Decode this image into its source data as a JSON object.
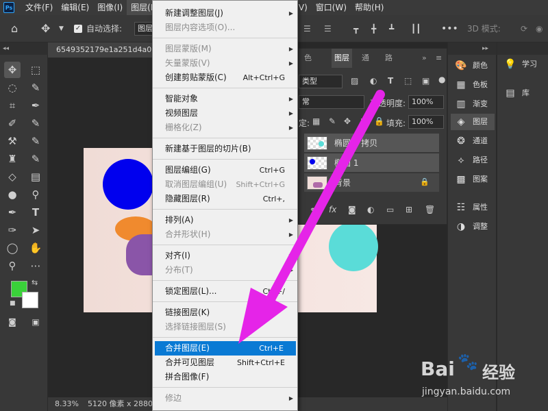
{
  "menubar": {
    "items": [
      "文件(F)",
      "编辑(E)",
      "图像(I)",
      "图层(L)",
      "(V)",
      "窗口(W)",
      "帮助(H)"
    ]
  },
  "options": {
    "auto_select_label": "自动选择:",
    "auto_select_value": "图层",
    "three_d_label": "3D 模式:"
  },
  "document": {
    "tab_title": "6549352179e1a251d4a028",
    "zoom": "8.33%",
    "size_info": "5120 像素 x 2880 像"
  },
  "layers_panel": {
    "tabs": [
      "色",
      "图层",
      "通",
      "路"
    ],
    "filter_kind": "类型",
    "blend_mode": "常",
    "opacity_label": "不透明度:",
    "opacity_value": "100%",
    "lock_label": "定:",
    "fill_label": "填充:",
    "fill_value": "100%",
    "layers": [
      {
        "name": "椭圆 1 拷贝"
      },
      {
        "name": "椭圆 1"
      },
      {
        "name": "背景"
      }
    ]
  },
  "right_panel": {
    "items": [
      {
        "icon": "palette-icon",
        "label": "颜色"
      },
      {
        "icon": "swatches-icon",
        "label": "色板"
      },
      {
        "icon": "gradient-icon",
        "label": "渐变"
      },
      {
        "icon": "layers-icon",
        "label": "图层"
      },
      {
        "icon": "channels-icon",
        "label": "通道"
      },
      {
        "icon": "paths-icon",
        "label": "路径"
      },
      {
        "icon": "patterns-icon",
        "label": "图案"
      },
      {
        "icon": "properties-icon",
        "label": "属性"
      },
      {
        "icon": "adjustments-icon",
        "label": "调整"
      }
    ],
    "learn_label": "学习",
    "library_label": "库"
  },
  "layer_menu": {
    "items": [
      {
        "label": "新建调整图层(J)",
        "shortcut": "",
        "submenu": true,
        "disabled": false
      },
      {
        "label": "图层内容选项(O)...",
        "shortcut": "",
        "submenu": false,
        "disabled": true
      },
      {
        "label": "图层蒙版(M)",
        "shortcut": "",
        "submenu": true,
        "disabled": true
      },
      {
        "label": "矢量蒙版(V)",
        "shortcut": "",
        "submenu": true,
        "disabled": true
      },
      {
        "label": "创建剪贴蒙版(C)",
        "shortcut": "Alt+Ctrl+G",
        "submenu": false,
        "disabled": false
      },
      {
        "label": "智能对象",
        "shortcut": "",
        "submenu": true,
        "disabled": false
      },
      {
        "label": "视频图层",
        "shortcut": "",
        "submenu": true,
        "disabled": false
      },
      {
        "label": "栅格化(Z)",
        "shortcut": "",
        "submenu": true,
        "disabled": true
      },
      {
        "label": "新建基于图层的切片(B)",
        "shortcut": "",
        "submenu": false,
        "disabled": false
      },
      {
        "label": "图层编组(G)",
        "shortcut": "Ctrl+G",
        "submenu": false,
        "disabled": false
      },
      {
        "label": "取消图层编组(U)",
        "shortcut": "Shift+Ctrl+G",
        "submenu": false,
        "disabled": true
      },
      {
        "label": "隐藏图层(R)",
        "shortcut": "Ctrl+,",
        "submenu": false,
        "disabled": false
      },
      {
        "label": "排列(A)",
        "shortcut": "",
        "submenu": true,
        "disabled": false
      },
      {
        "label": "合并形状(H)",
        "shortcut": "",
        "submenu": true,
        "disabled": true
      },
      {
        "label": "对齐(I)",
        "shortcut": "",
        "submenu": true,
        "disabled": false
      },
      {
        "label": "分布(T)",
        "shortcut": "",
        "submenu": true,
        "disabled": true
      },
      {
        "label": "锁定图层(L)...",
        "shortcut": "Ctrl+/",
        "submenu": false,
        "disabled": false
      },
      {
        "label": "链接图层(K)",
        "shortcut": "",
        "submenu": false,
        "disabled": false
      },
      {
        "label": "选择链接图层(S)",
        "shortcut": "",
        "submenu": false,
        "disabled": true
      },
      {
        "label": "合并图层(E)",
        "shortcut": "Ctrl+E",
        "submenu": false,
        "disabled": false,
        "highlighted": true
      },
      {
        "label": "合并可见图层",
        "shortcut": "Shift+Ctrl+E",
        "submenu": false,
        "disabled": false
      },
      {
        "label": "拼合图像(F)",
        "shortcut": "",
        "submenu": false,
        "disabled": false
      },
      {
        "label": "修边",
        "shortcut": "",
        "submenu": true,
        "disabled": true
      }
    ]
  },
  "watermark": {
    "brand_left": "Bai",
    "brand_right": "经验",
    "url": "jingyan.baidu.com"
  },
  "colors": {
    "foreground": "#3ad13a",
    "background": "#ffffff",
    "ellipse_blue": "#0000ee",
    "ellipse_cyan": "#5adcd8",
    "menu_highlight": "#0a7ad4",
    "arrow": "#e524e8"
  }
}
